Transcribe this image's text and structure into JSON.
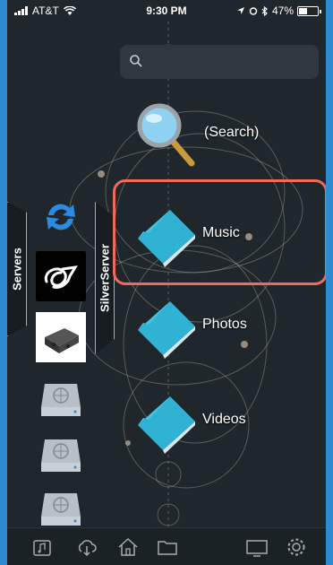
{
  "status_bar": {
    "carrier": "AT&T",
    "time": "9:30 PM",
    "battery": "47%",
    "battery_level": 0.47
  },
  "search": {
    "placeholder": ""
  },
  "sidebar": {
    "servers_tab": "Servers",
    "selected_server_tab": "SilverServer",
    "server_icons": [
      "sync-icon",
      "silverserver-logo-icon",
      "media-box-icon",
      "network-drive-icon",
      "network-drive-icon",
      "network-drive-icon"
    ]
  },
  "media": {
    "items": [
      {
        "label": "(Search)",
        "icon": "magnifier-icon"
      },
      {
        "label": "Music",
        "icon": "folder-icon"
      },
      {
        "label": "Photos",
        "icon": "folder-icon"
      },
      {
        "label": "Videos",
        "icon": "folder-icon"
      }
    ]
  },
  "tabbar": {
    "icons": [
      "music-library-icon",
      "cloud-download-icon",
      "home-icon",
      "folder-icon",
      "tv-icon",
      "settings-icon"
    ]
  },
  "colors": {
    "background": "#1f272d",
    "accent_blue": "#2c8bd1",
    "folder": "#2fb2d3",
    "highlight": "#ef6a5a"
  }
}
